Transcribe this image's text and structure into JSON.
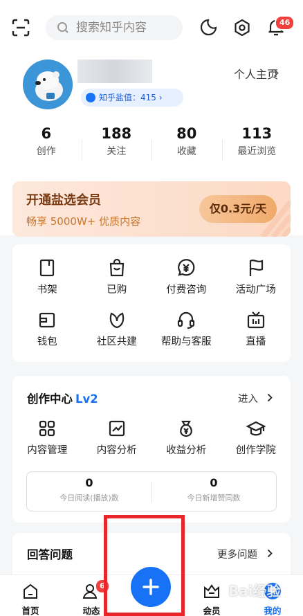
{
  "header": {
    "search_placeholder": "搜索知乎内容",
    "notification_badge": "46",
    "icons": [
      "scan-icon",
      "search-icon",
      "moon-icon",
      "settings-icon",
      "bell-icon"
    ]
  },
  "profile": {
    "salt_label": "知乎盐值：415",
    "homepage_link": "个人主页"
  },
  "stats": [
    {
      "num": "6",
      "label": "创作"
    },
    {
      "num": "188",
      "label": "关注"
    },
    {
      "num": "80",
      "label": "收藏"
    },
    {
      "num": "113",
      "label": "最近浏览"
    }
  ],
  "vip": {
    "title": "开通盐选会员",
    "subtitle": "畅享 5000W+ 优质内容",
    "button": "仅0.3元/天"
  },
  "services": [
    {
      "label": "书架",
      "icon": "bookshelf-icon"
    },
    {
      "label": "已购",
      "icon": "shopping-bag-icon"
    },
    {
      "label": "付费咨询",
      "icon": "paid-consult-icon"
    },
    {
      "label": "活动广场",
      "icon": "flag-icon"
    },
    {
      "label": "钱包",
      "icon": "wallet-icon"
    },
    {
      "label": "社区共建",
      "icon": "leaf-icon"
    },
    {
      "label": "帮助与客服",
      "icon": "headset-icon"
    },
    {
      "label": "直播",
      "icon": "tv-icon"
    }
  ],
  "creation": {
    "title": "创作中心",
    "level": "Lv2",
    "enter": "进入",
    "items": [
      {
        "label": "内容管理",
        "icon": "grid-icon"
      },
      {
        "label": "内容分析",
        "icon": "chart-icon"
      },
      {
        "label": "收益分析",
        "icon": "money-bag-icon"
      },
      {
        "label": "创作学院",
        "icon": "graduation-cap-icon"
      }
    ],
    "today": [
      {
        "num": "0",
        "label": "今日阅读(播放)数"
      },
      {
        "num": "0",
        "label": "今日新增赞同数"
      }
    ]
  },
  "answers": {
    "title": "回答问题",
    "more": "更多问题"
  },
  "tabbar": {
    "home": "首页",
    "feed": "动态",
    "feed_badge": "6",
    "vip": "会员",
    "mine": "我的"
  },
  "watermark": "Bai经验",
  "colors": {
    "accent": "#1772f6",
    "badge": "#f1403c",
    "highlight_box": "#e8262b"
  }
}
